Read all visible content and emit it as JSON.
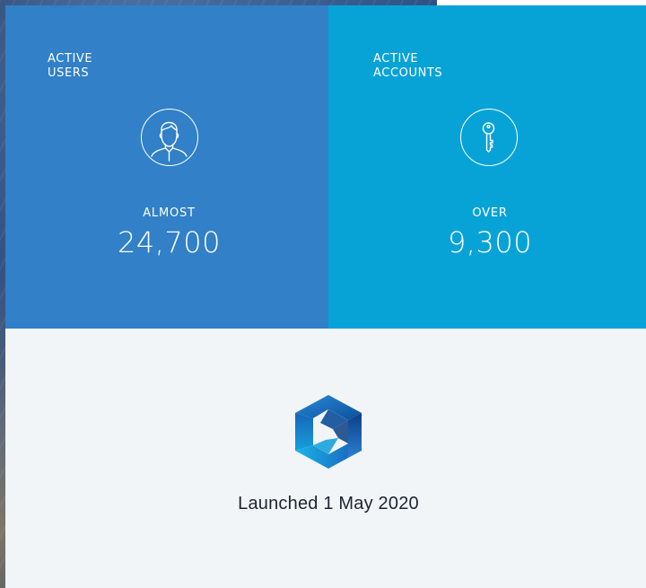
{
  "stats": {
    "users": {
      "label_line1": "ACTIVE",
      "label_line2": "USERS",
      "icon": "user-icon",
      "qualifier": "ALMOST",
      "value": "24,700",
      "color": "#3180c8"
    },
    "accounts": {
      "label_line1": "ACTIVE",
      "label_line2": "ACCOUNTS",
      "icon": "key-icon",
      "qualifier": "OVER",
      "value": "9,300",
      "color": "#08a3d6"
    }
  },
  "launch": {
    "logo_icon": "hexagon-logo-icon",
    "text": "Launched 1 May 2020",
    "background": "#f1f5f7"
  }
}
